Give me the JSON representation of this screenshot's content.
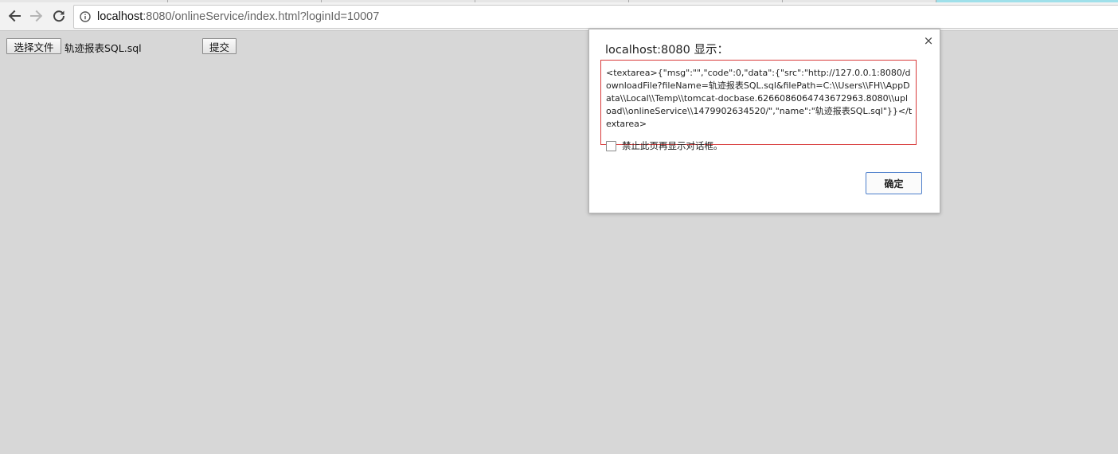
{
  "browser": {
    "url_host": "localhost",
    "url_rest": ":8080/onlineService/index.html?loginId=10007"
  },
  "page": {
    "choose_file_label": "选择文件",
    "file_name": "轨迹报表SQL.sql",
    "submit_label": "提交"
  },
  "dialog": {
    "title": "localhost:8080 显示：",
    "message": "<textarea>{\"msg\":\"\",\"code\":0,\"data\":{\"src\":\"http://127.0.0.1:8080/downloadFile?fileName=轨迹报表SQL.sql&filePath=C:\\\\Users\\\\FH\\\\AppData\\\\Local\\\\Temp\\\\tomcat-docbase.6266086064743672963.8080\\\\upload\\\\onlineService\\\\1479902634520/\",\"name\":\"轨迹报表SQL.sql\"}}</textarea>",
    "suppress_label": "禁止此页再显示对话框。",
    "ok_label": "确定",
    "close_glyph": "×"
  },
  "colors": {
    "highlight_border": "#d83a3a",
    "ok_border": "#4d7fcb",
    "page_background": "#d7d7d7"
  }
}
